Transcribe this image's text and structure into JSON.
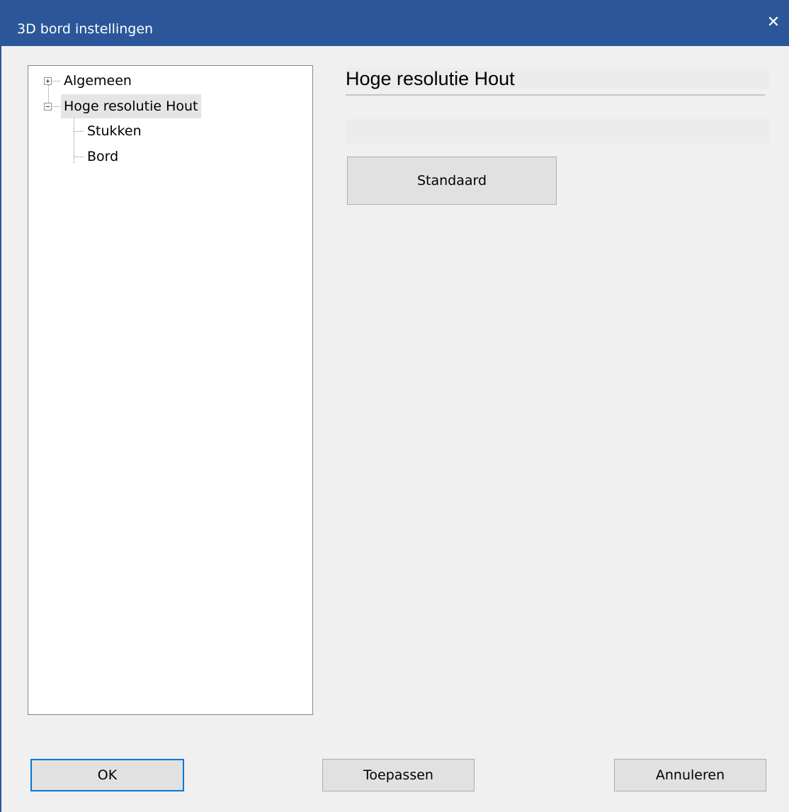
{
  "window": {
    "title": "3D bord instellingen",
    "close_glyph": "✕",
    "titlebar_color": "#2b579a",
    "background_color": "#f0f0f0"
  },
  "tree": {
    "items": [
      {
        "label": "Algemeen",
        "expander": "plus",
        "selected": false
      },
      {
        "label": "Hoge resolutie Hout",
        "expander": "minus",
        "selected": true
      },
      {
        "label": "Stukken",
        "expander": null,
        "selected": false
      },
      {
        "label": "Bord",
        "expander": null,
        "selected": false
      }
    ]
  },
  "panel": {
    "heading": "Hoge resolutie Hout",
    "default_button_label": "Standaard"
  },
  "footer": {
    "ok_label": "OK",
    "apply_label": "Toepassen",
    "cancel_label": "Annuleren"
  },
  "icons": {
    "close": "close-icon",
    "expand": "plus-expander-icon",
    "collapse": "minus-expander-icon"
  },
  "colors": {
    "accent": "#0078d7",
    "selection": "#e5e5e5"
  }
}
